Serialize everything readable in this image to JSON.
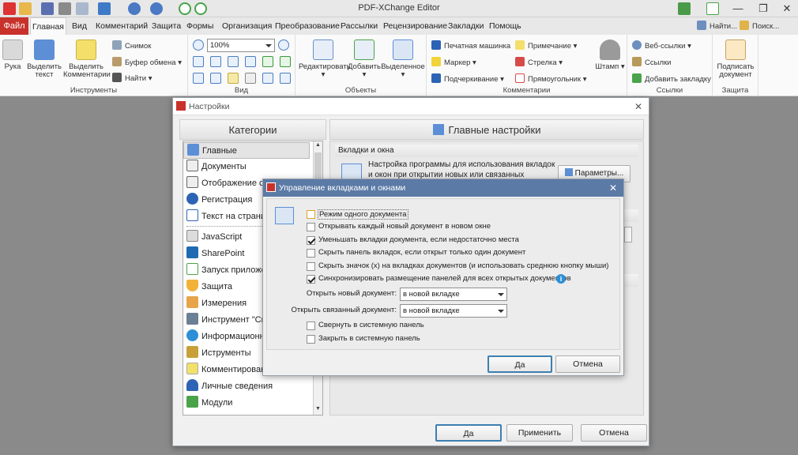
{
  "app": {
    "title": "PDF-XChange Editor"
  },
  "tabs": [
    "Файл",
    "Главная",
    "Вид",
    "Комментарий",
    "Защита",
    "Формы",
    "Организация",
    "Преобразование",
    "Рассылки",
    "Рецензирование",
    "Закладки",
    "Помощь"
  ],
  "search": {
    "find": "Найти...",
    "search": "Поиск..."
  },
  "ribbon": {
    "tools": {
      "hand": "Рука",
      "select_text": "Выделить текст",
      "select_comments": "Выделить Комментарии",
      "snapshot": "Снимок",
      "clipboard": "Буфер обмена",
      "find": "Найти",
      "label": "Инструменты"
    },
    "view": {
      "zoom": "100%",
      "label": "Вид"
    },
    "objects": {
      "edit": "Редактировать",
      "add": "Добавить",
      "selected": "Выделенное",
      "label": "Объекты"
    },
    "comments": {
      "typewriter": "Печатная машинка",
      "marker": "Маркер",
      "underline": "Подчеркивание",
      "note": "Примечание",
      "arrow": "Стрелка",
      "rectangle": "Прямоугольник",
      "stamp": "Штамп",
      "label": "Комментарии"
    },
    "links": {
      "web_links": "Веб-ссылки",
      "links": "Ссылки",
      "add_bookmark": "Добавить закладку",
      "label": "Ссылки"
    },
    "protect": {
      "sign": "Подписать документ",
      "label": "Защита"
    }
  },
  "settings": {
    "title": "Настройки",
    "categories_header": "Категории",
    "main_header": "Главные настройки",
    "categories": [
      "Главные",
      "Документы",
      "Отображение ст",
      "Регистрация",
      "Текст на страни",
      "JavaScript",
      "SharePoint",
      "Запуск приложе",
      "Защита",
      "Измерения",
      "Инструмент \"Сн",
      "Информационн",
      "Иструменты",
      "Комментирован",
      "Личные сведения",
      "Модули"
    ],
    "section_tabs": "Вкладки и окна",
    "section_desc": "Настройка программы для использования вкладок и окон при открытии новых или связанных документов,",
    "params_button": "Параметры...",
    "ok": "Да",
    "apply": "Применить",
    "cancel": "Отмена"
  },
  "tabdialog": {
    "title": "Управление вкладками и окнами",
    "options": [
      {
        "label": "Режим одного документа",
        "checked": false
      },
      {
        "label": "Открывать каждый новый документ в новом окне",
        "checked": false
      },
      {
        "label": "Уменьшать вкладки документа, если недостаточно места",
        "checked": true
      },
      {
        "label": "Скрыть панель вкладок, если открыт только один документ",
        "checked": false
      },
      {
        "label": "Скрыть значок (x) на вкладках документов (и использовать среднюю кнопку мыши)",
        "checked": false
      },
      {
        "label": "Синхронизировать размещение панелей для всех открытых документов",
        "checked": true
      }
    ],
    "open_new_label": "Открыть новый документ:",
    "open_new_value": "в новой вкладке",
    "open_linked_label": "Открыть связанный документ:",
    "open_linked_value": "в новой вкладке",
    "tray_options": [
      {
        "label": "Свернуть в системную панель",
        "checked": false
      },
      {
        "label": "Закрыть в системную панель",
        "checked": false
      }
    ],
    "ok": "Да",
    "cancel": "Отмена"
  }
}
